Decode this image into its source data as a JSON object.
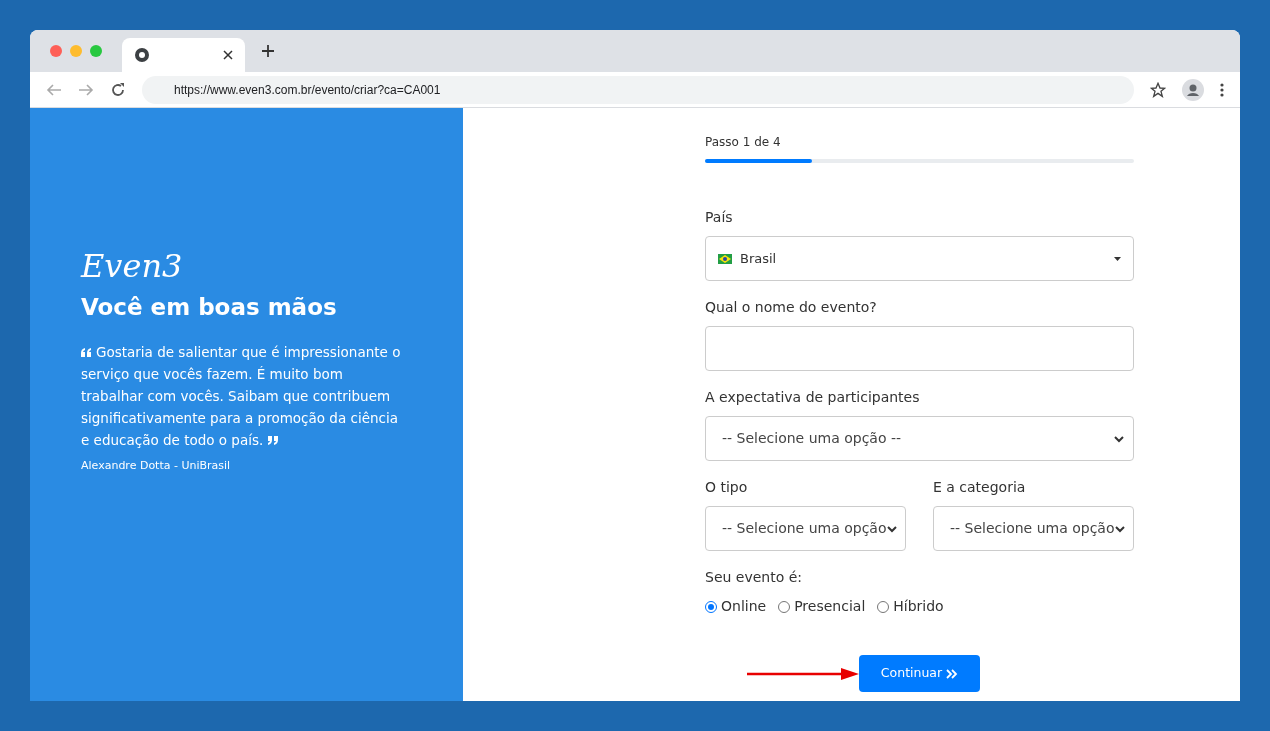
{
  "browser": {
    "url": "https://www.even3.com.br/evento/criar?ca=CA001"
  },
  "side": {
    "logo": "Even3",
    "heading": "Você em boas mãos",
    "quote": "Gostaria de salientar que é impressionante o serviço que vocês fazem. É muito bom trabalhar com vocês. Saibam que contribuem significativamente para a promoção da ciência e educação de todo o país.",
    "author": "Alexandre Dotta - UniBrasil"
  },
  "progress": {
    "label": "Passo 1 de 4",
    "level": 0.25
  },
  "country": {
    "label": "País",
    "value": "Brasil"
  },
  "event_name": {
    "label": "Qual o nome do evento?"
  },
  "attendance": {
    "label": "A expectativa de participantes",
    "value": "-- Selecione uma opção --"
  },
  "type": {
    "label": "O tipo",
    "value": "-- Selecione uma opção"
  },
  "category": {
    "label": "E a categoria",
    "value": "-- Selecione uma opção"
  },
  "mode": {
    "label": "Seu evento é:",
    "options": [
      {
        "label": "Online",
        "selected": true
      },
      {
        "label": "Presencial",
        "selected": false
      },
      {
        "label": "Híbrido",
        "selected": false
      }
    ]
  },
  "submit": {
    "label": "Continuar"
  }
}
